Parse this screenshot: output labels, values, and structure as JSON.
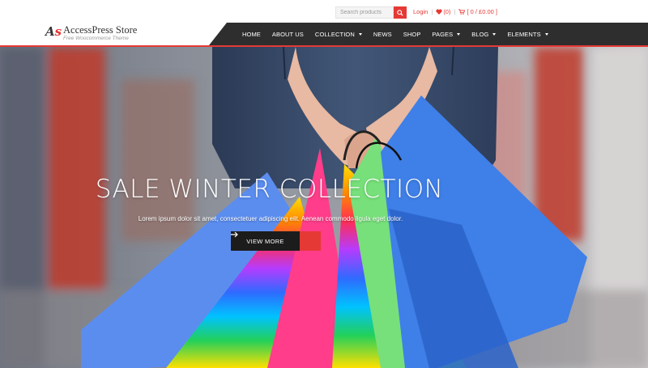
{
  "brand": {
    "name": "AccessPress Store",
    "tagline": "Free Woocommerce Theme",
    "mark": "AS",
    "accent_color": "#e53935"
  },
  "topbar": {
    "search_placeholder": "Search products",
    "login_label": "Login",
    "wishlist_count": "(0)",
    "cart_summary": "[ 0 / £0.00 ]"
  },
  "nav": {
    "items": [
      {
        "label": "HOME"
      },
      {
        "label": "ABOUT US"
      },
      {
        "label": "COLLECTION"
      },
      {
        "label": "NEWS"
      },
      {
        "label": "SHOP"
      },
      {
        "label": "PAGES"
      },
      {
        "label": "BLOG"
      },
      {
        "label": "ELEMENTS"
      }
    ]
  },
  "hero": {
    "title": "SALE WINTER COLLECTION",
    "subtitle": "Lorem ipsum dolor sit amet, consectetuer adipiscing elit. Aenean commodo ligula eget dolor.",
    "cta_label": "VIEW MORE"
  }
}
